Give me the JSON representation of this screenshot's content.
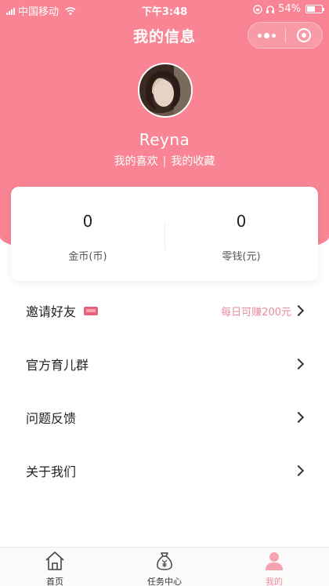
{
  "status_bar": {
    "carrier": "中国移动",
    "time": "下午3:48",
    "battery_percent": "54%",
    "battery_level": 0.54
  },
  "nav": {
    "title": "我的信息",
    "capsule_icons": [
      "more-icon",
      "target-icon"
    ]
  },
  "profile": {
    "username": "Reyna",
    "link_likes": "我的喜欢",
    "separator": "|",
    "link_favorites": "我的收藏"
  },
  "stats": [
    {
      "value": "0",
      "label": "金币(币)"
    },
    {
      "value": "0",
      "label": "零钱(元)"
    }
  ],
  "menu": [
    {
      "label": "邀请好友",
      "note": "每日可赚200元",
      "badge_icon": "flag-icon"
    },
    {
      "label": "官方育儿群",
      "note": ""
    },
    {
      "label": "问题反馈",
      "note": ""
    },
    {
      "label": "关于我们",
      "note": ""
    }
  ],
  "tabbar": {
    "items": [
      {
        "label": "首页",
        "icon": "home-icon",
        "active": false
      },
      {
        "label": "任务中心",
        "icon": "money-bag-icon",
        "active": false
      },
      {
        "label": "我的",
        "icon": "profile-icon",
        "active": true
      }
    ]
  },
  "colors": {
    "brand_pink": "#f88494",
    "accent_text": "#ea8a9a",
    "active_tab": "#f08b9c"
  }
}
